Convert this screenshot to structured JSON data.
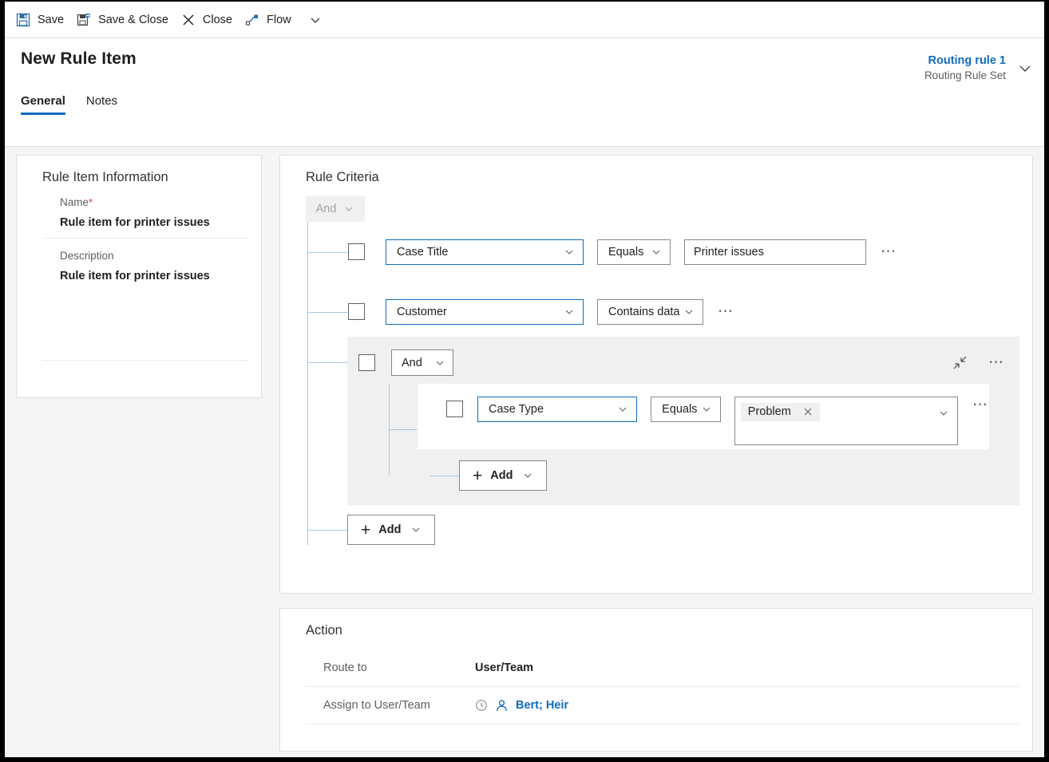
{
  "commandbar": {
    "items": [
      {
        "label": "Save",
        "icon": "save-icon"
      },
      {
        "label": "Save & Close",
        "icon": "save-and-close-icon"
      },
      {
        "label": "Close",
        "icon": "close-x-icon"
      },
      {
        "label": "Flow",
        "icon": "flow-icon"
      }
    ],
    "overflow_icon": "chevron-down-icon"
  },
  "header": {
    "title": "New Rule Item",
    "tabs": [
      {
        "label": "General",
        "active": true
      },
      {
        "label": "Notes",
        "active": false
      }
    ],
    "record": {
      "title": "Routing rule 1",
      "subtitle": "Routing Rule Set",
      "expand_icon": "chevron-down-icon"
    }
  },
  "rule_item_information": {
    "section_title": "Rule Item Information",
    "name_label": "Name",
    "name_required_marker": "*",
    "name_value": "Rule item for printer issues",
    "description_label": "Description",
    "description_value": "Rule item for printer issues"
  },
  "rule_criteria": {
    "section_title": "Rule Criteria",
    "root_operator": "And",
    "root_operator_disabled": true,
    "rows": [
      {
        "field": "Case Title",
        "operator": "Equals",
        "value": "Printer issues",
        "has_value_box": true,
        "more_icon": "ellipsis-icon"
      },
      {
        "field": "Customer",
        "operator": "Contains data",
        "value": "",
        "has_value_box": false,
        "more_icon": "ellipsis-icon"
      }
    ],
    "group": {
      "operator": "And",
      "collapse_icon": "collapse-arrows-icon",
      "more_icon": "ellipsis-icon",
      "rows": [
        {
          "field": "Case Type",
          "operator": "Equals",
          "tags": [
            {
              "label": "Problem",
              "remove_icon": "close-x-icon"
            }
          ],
          "dropdown_icon": "chevron-down-icon",
          "more_icon": "ellipsis-icon"
        }
      ],
      "add_label": "Add"
    },
    "add_label": "Add"
  },
  "action": {
    "section_title": "Action",
    "route_to_label": "Route to",
    "route_to_value": "User/Team",
    "assign_label": "Assign to User/Team",
    "assign_value": "Bert; Heir",
    "assign_recent_icon": "recent-clock-icon",
    "assign_person_icon": "person-icon"
  },
  "colors": {
    "accent": "#0f6cbd",
    "required": "#d13438",
    "tree_line": "#a6c8e8",
    "group_bg": "#f0f0f0",
    "page_bg": "#f5f5f5",
    "border": "#8a8886"
  }
}
